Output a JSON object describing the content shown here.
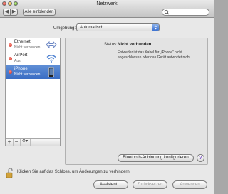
{
  "window": {
    "title": "Netzwerk"
  },
  "toolbar": {
    "back": "◀",
    "forward": "▶",
    "show_all": "Alle einblenden",
    "search_placeholder": ""
  },
  "location": {
    "label": "Umgebung:",
    "value": "Automatisch"
  },
  "services": [
    {
      "name": "Ethernet",
      "status": "Nicht verbunden",
      "icon": "ethernet-arrows-icon",
      "selected": false
    },
    {
      "name": "AirPort",
      "status": "Aus",
      "icon": "wifi-icon",
      "selected": false
    },
    {
      "name": "iPhone",
      "status": "Nicht verbunden",
      "icon": "iphone-icon",
      "selected": true
    }
  ],
  "sidebar_controls": {
    "add": "+",
    "remove": "−",
    "action": "⚙▾"
  },
  "detail": {
    "status_label": "Status:",
    "status_value": "Nicht verbunden",
    "status_description": "Entweder ist das Kabel für „iPhone“ nicht angeschlossen oder das Gerät antwortet nicht.",
    "bluetooth_button": "Bluetooth-Anbindung konfigurieren",
    "help": "?"
  },
  "lock": {
    "text": "Klicken Sie auf das Schloss, um Änderungen zu verhindern."
  },
  "buttons": {
    "assistant": "Assistent ...",
    "revert": "Zurücksetzen",
    "apply": "Anwenden"
  },
  "colors": {
    "selection": "#3a6dc4",
    "status_dot": "#d3382b",
    "accent": "#3d72d1"
  }
}
